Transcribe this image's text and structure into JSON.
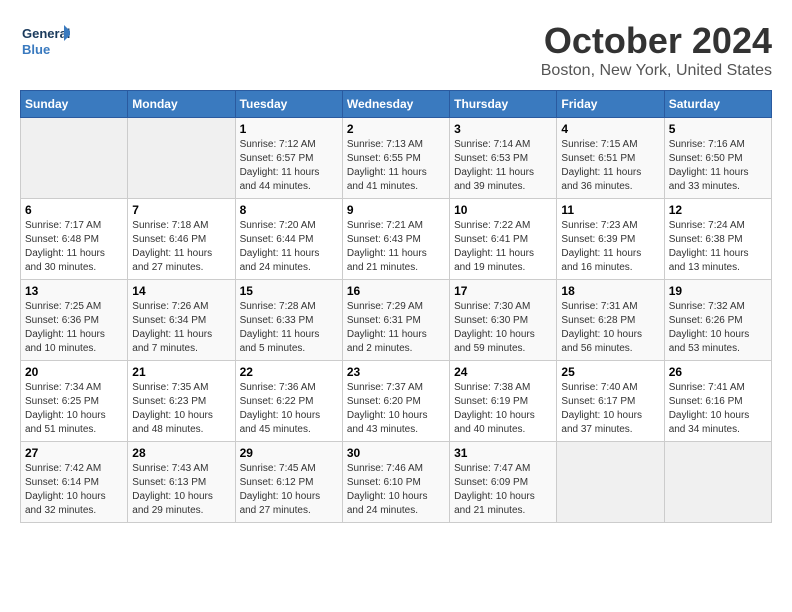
{
  "header": {
    "logo_text_general": "General",
    "logo_text_blue": "Blue",
    "month_title": "October 2024",
    "location": "Boston, New York, United States"
  },
  "weekdays": [
    "Sunday",
    "Monday",
    "Tuesday",
    "Wednesday",
    "Thursday",
    "Friday",
    "Saturday"
  ],
  "weeks": [
    [
      {
        "day": "",
        "empty": true
      },
      {
        "day": "",
        "empty": true
      },
      {
        "day": "1",
        "sunrise": "7:12 AM",
        "sunset": "6:57 PM",
        "daylight": "11 hours and 44 minutes."
      },
      {
        "day": "2",
        "sunrise": "7:13 AM",
        "sunset": "6:55 PM",
        "daylight": "11 hours and 41 minutes."
      },
      {
        "day": "3",
        "sunrise": "7:14 AM",
        "sunset": "6:53 PM",
        "daylight": "11 hours and 39 minutes."
      },
      {
        "day": "4",
        "sunrise": "7:15 AM",
        "sunset": "6:51 PM",
        "daylight": "11 hours and 36 minutes."
      },
      {
        "day": "5",
        "sunrise": "7:16 AM",
        "sunset": "6:50 PM",
        "daylight": "11 hours and 33 minutes."
      }
    ],
    [
      {
        "day": "6",
        "sunrise": "7:17 AM",
        "sunset": "6:48 PM",
        "daylight": "11 hours and 30 minutes."
      },
      {
        "day": "7",
        "sunrise": "7:18 AM",
        "sunset": "6:46 PM",
        "daylight": "11 hours and 27 minutes."
      },
      {
        "day": "8",
        "sunrise": "7:20 AM",
        "sunset": "6:44 PM",
        "daylight": "11 hours and 24 minutes."
      },
      {
        "day": "9",
        "sunrise": "7:21 AM",
        "sunset": "6:43 PM",
        "daylight": "11 hours and 21 minutes."
      },
      {
        "day": "10",
        "sunrise": "7:22 AM",
        "sunset": "6:41 PM",
        "daylight": "11 hours and 19 minutes."
      },
      {
        "day": "11",
        "sunrise": "7:23 AM",
        "sunset": "6:39 PM",
        "daylight": "11 hours and 16 minutes."
      },
      {
        "day": "12",
        "sunrise": "7:24 AM",
        "sunset": "6:38 PM",
        "daylight": "11 hours and 13 minutes."
      }
    ],
    [
      {
        "day": "13",
        "sunrise": "7:25 AM",
        "sunset": "6:36 PM",
        "daylight": "11 hours and 10 minutes."
      },
      {
        "day": "14",
        "sunrise": "7:26 AM",
        "sunset": "6:34 PM",
        "daylight": "11 hours and 7 minutes."
      },
      {
        "day": "15",
        "sunrise": "7:28 AM",
        "sunset": "6:33 PM",
        "daylight": "11 hours and 5 minutes."
      },
      {
        "day": "16",
        "sunrise": "7:29 AM",
        "sunset": "6:31 PM",
        "daylight": "11 hours and 2 minutes."
      },
      {
        "day": "17",
        "sunrise": "7:30 AM",
        "sunset": "6:30 PM",
        "daylight": "10 hours and 59 minutes."
      },
      {
        "day": "18",
        "sunrise": "7:31 AM",
        "sunset": "6:28 PM",
        "daylight": "10 hours and 56 minutes."
      },
      {
        "day": "19",
        "sunrise": "7:32 AM",
        "sunset": "6:26 PM",
        "daylight": "10 hours and 53 minutes."
      }
    ],
    [
      {
        "day": "20",
        "sunrise": "7:34 AM",
        "sunset": "6:25 PM",
        "daylight": "10 hours and 51 minutes."
      },
      {
        "day": "21",
        "sunrise": "7:35 AM",
        "sunset": "6:23 PM",
        "daylight": "10 hours and 48 minutes."
      },
      {
        "day": "22",
        "sunrise": "7:36 AM",
        "sunset": "6:22 PM",
        "daylight": "10 hours and 45 minutes."
      },
      {
        "day": "23",
        "sunrise": "7:37 AM",
        "sunset": "6:20 PM",
        "daylight": "10 hours and 43 minutes."
      },
      {
        "day": "24",
        "sunrise": "7:38 AM",
        "sunset": "6:19 PM",
        "daylight": "10 hours and 40 minutes."
      },
      {
        "day": "25",
        "sunrise": "7:40 AM",
        "sunset": "6:17 PM",
        "daylight": "10 hours and 37 minutes."
      },
      {
        "day": "26",
        "sunrise": "7:41 AM",
        "sunset": "6:16 PM",
        "daylight": "10 hours and 34 minutes."
      }
    ],
    [
      {
        "day": "27",
        "sunrise": "7:42 AM",
        "sunset": "6:14 PM",
        "daylight": "10 hours and 32 minutes."
      },
      {
        "day": "28",
        "sunrise": "7:43 AM",
        "sunset": "6:13 PM",
        "daylight": "10 hours and 29 minutes."
      },
      {
        "day": "29",
        "sunrise": "7:45 AM",
        "sunset": "6:12 PM",
        "daylight": "10 hours and 27 minutes."
      },
      {
        "day": "30",
        "sunrise": "7:46 AM",
        "sunset": "6:10 PM",
        "daylight": "10 hours and 24 minutes."
      },
      {
        "day": "31",
        "sunrise": "7:47 AM",
        "sunset": "6:09 PM",
        "daylight": "10 hours and 21 minutes."
      },
      {
        "day": "",
        "empty": true
      },
      {
        "day": "",
        "empty": true
      }
    ]
  ]
}
